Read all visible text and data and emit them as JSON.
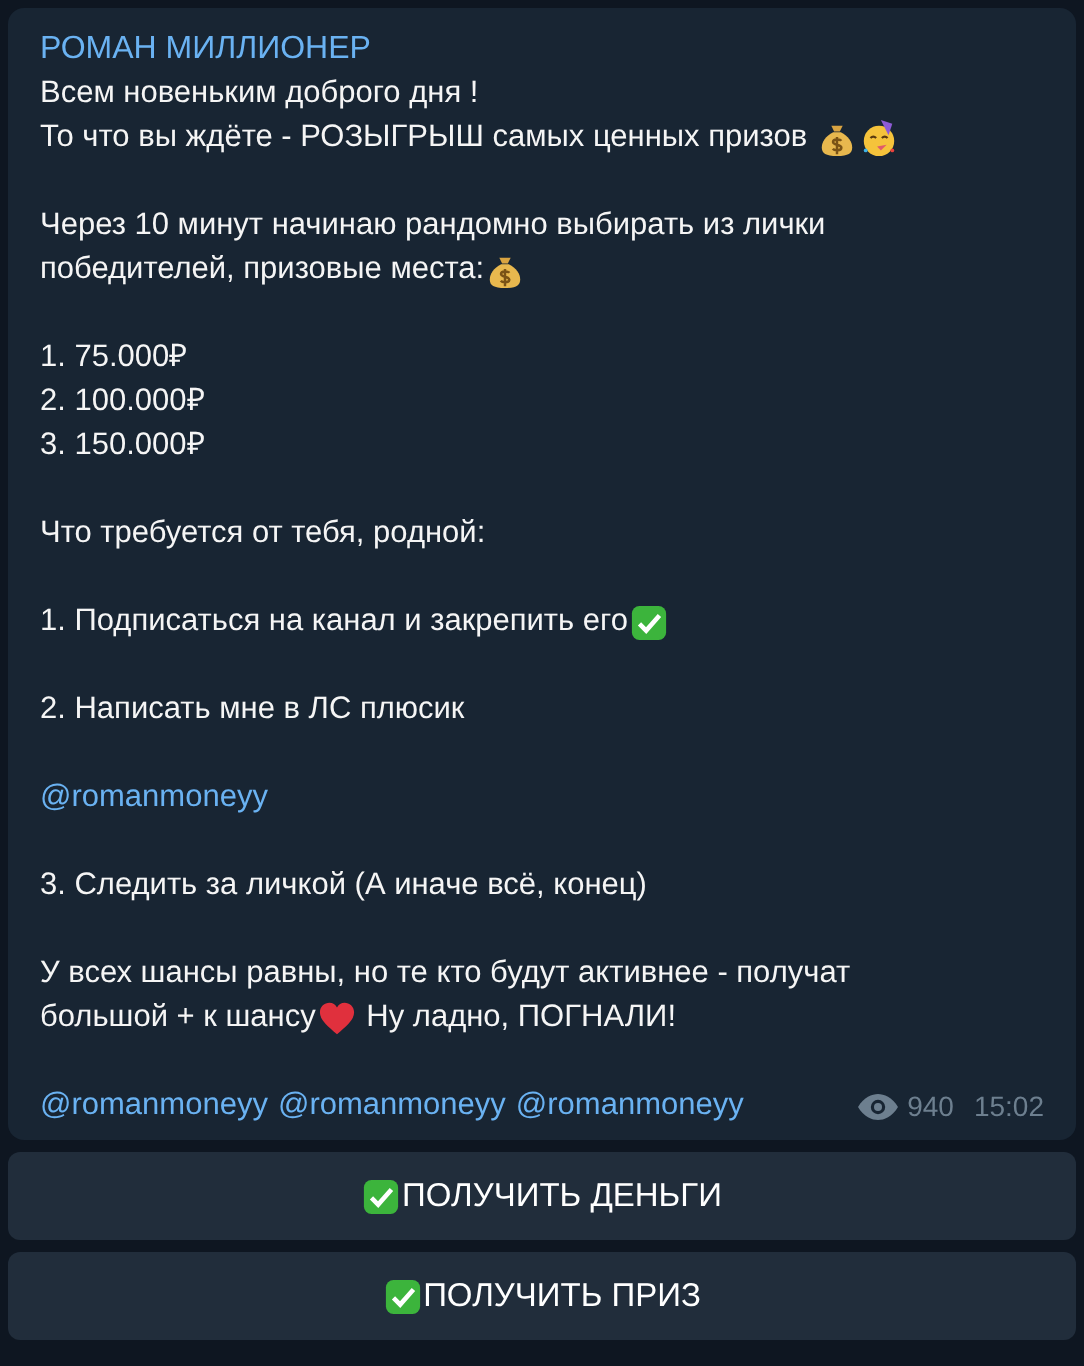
{
  "message": {
    "author": "РОМАН МИЛЛИОНЕР",
    "paragraphs": [
      {
        "lines": [
          [
            {
              "kind": "text",
              "text": "Всем новеньким доброго дня !"
            }
          ],
          [
            {
              "kind": "text",
              "text": "То что вы ждёте - РОЗЫГРЫШ самых ценных призов "
            },
            {
              "kind": "money"
            },
            {
              "kind": "party"
            }
          ]
        ]
      },
      {
        "lines": [
          [
            {
              "kind": "text",
              "text": "Через 10 минут начинаю рандомно выбирать из лички"
            }
          ],
          [
            {
              "kind": "text",
              "text": "победителей, призовые места:"
            },
            {
              "kind": "money"
            }
          ]
        ]
      },
      {
        "lines": [
          [
            {
              "kind": "text",
              "text": "1. 75.000₽"
            }
          ],
          [
            {
              "kind": "text",
              "text": "2. 100.000₽"
            }
          ],
          [
            {
              "kind": "text",
              "text": "3. 150.000₽"
            }
          ]
        ]
      },
      {
        "lines": [
          [
            {
              "kind": "text",
              "text": "Что требуется от тебя, родной:"
            }
          ]
        ]
      },
      {
        "lines": [
          [
            {
              "kind": "text",
              "text": "1. Подписаться на канал и закрепить его"
            },
            {
              "kind": "check"
            }
          ]
        ]
      },
      {
        "lines": [
          [
            {
              "kind": "text",
              "text": "2. Написать мне в ЛС плюсик"
            }
          ]
        ]
      },
      {
        "lines": [
          [
            {
              "kind": "link",
              "text": "@romanmoneyy"
            }
          ]
        ]
      },
      {
        "lines": [
          [
            {
              "kind": "text",
              "text": "3. Следить за личкой (А иначе всё, конец)"
            }
          ]
        ]
      },
      {
        "lines": [
          [
            {
              "kind": "text",
              "text": "У всех шансы равны, но те кто будут активнее - получат"
            }
          ],
          [
            {
              "kind": "text",
              "text": "большой + к шансу"
            },
            {
              "kind": "heart"
            },
            {
              "kind": "text",
              "text": " Ну ладно, ПОГНАЛИ!"
            }
          ]
        ]
      },
      {
        "lines": [
          [
            {
              "kind": "link",
              "text": "@romanmoneyy"
            },
            {
              "kind": "link",
              "text": "@romanmoneyy"
            },
            {
              "kind": "link",
              "text": "@romanmoneyy"
            }
          ]
        ]
      }
    ],
    "views": "940",
    "time": "15:02"
  },
  "buttons": [
    {
      "kind": "check",
      "label": "ПОЛУЧИТЬ ДЕНЬГИ"
    },
    {
      "kind": "check",
      "label": "ПОЛУЧИТЬ ПРИЗ"
    }
  ]
}
